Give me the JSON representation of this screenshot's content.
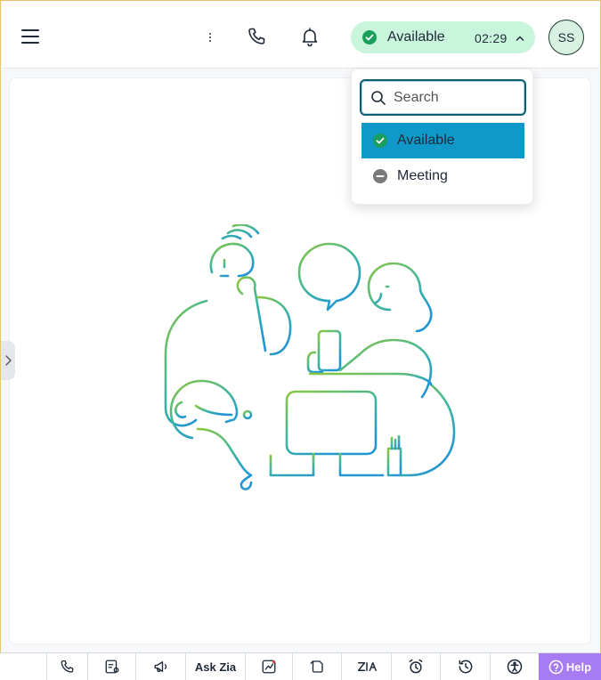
{
  "header": {
    "status": {
      "label": "Available",
      "timer": "02:29"
    },
    "avatar_initials": "SS"
  },
  "status_menu": {
    "search_placeholder": "Search",
    "options": [
      {
        "label": "Available",
        "selected": true
      },
      {
        "label": "Meeting",
        "selected": false
      }
    ]
  },
  "bottom_bar": {
    "ask_zia": "Ask Zia",
    "help": "Help"
  },
  "colors": {
    "status_pill_bg": "#c8f5dc",
    "selected_option_bg": "#0e99c9",
    "help_bg": "#a77cf2",
    "available_green": "#1a9e5c"
  },
  "icons": [
    "menu-icon",
    "more-vertical-icon",
    "phone-icon",
    "bell-icon",
    "check-circle-icon",
    "chevron-up-icon",
    "search-icon",
    "minus-circle-icon",
    "chevron-right-icon",
    "calls-icon",
    "dialer-settings-icon",
    "campaign-icon",
    "analytics-icon",
    "notes-icon",
    "zia-icon",
    "alarm-icon",
    "history-icon",
    "accessibility-icon",
    "help-icon"
  ]
}
